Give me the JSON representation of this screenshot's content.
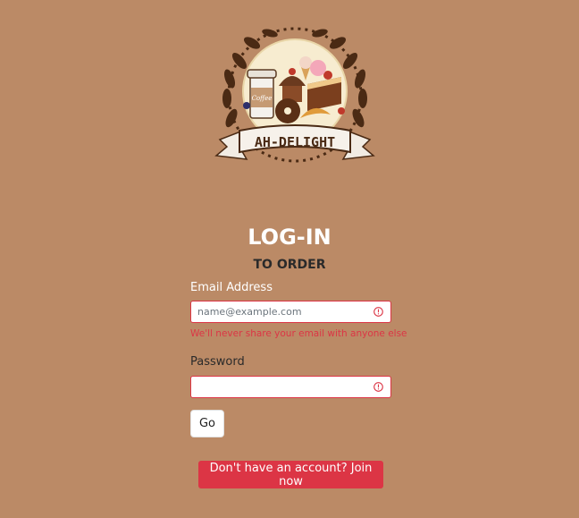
{
  "logo": {
    "text": "AH-DELIGHT",
    "cup_text": "Coffee"
  },
  "header": {
    "title": "LOG-IN",
    "subtitle": "TO ORDER"
  },
  "form": {
    "email": {
      "label": "Email Address",
      "placeholder": "name@example.com",
      "value": "",
      "help": "We'll never share your email with anyone else"
    },
    "password": {
      "label": "Password",
      "value": ""
    },
    "submit_label": "Go"
  },
  "join": {
    "label": "Don't have an account? Join now"
  },
  "colors": {
    "background": "#bb8a66",
    "error": "#dc3545",
    "logo_dark": "#4a2a14"
  },
  "icons": {
    "field_warning": "exclamation-circle-icon"
  }
}
